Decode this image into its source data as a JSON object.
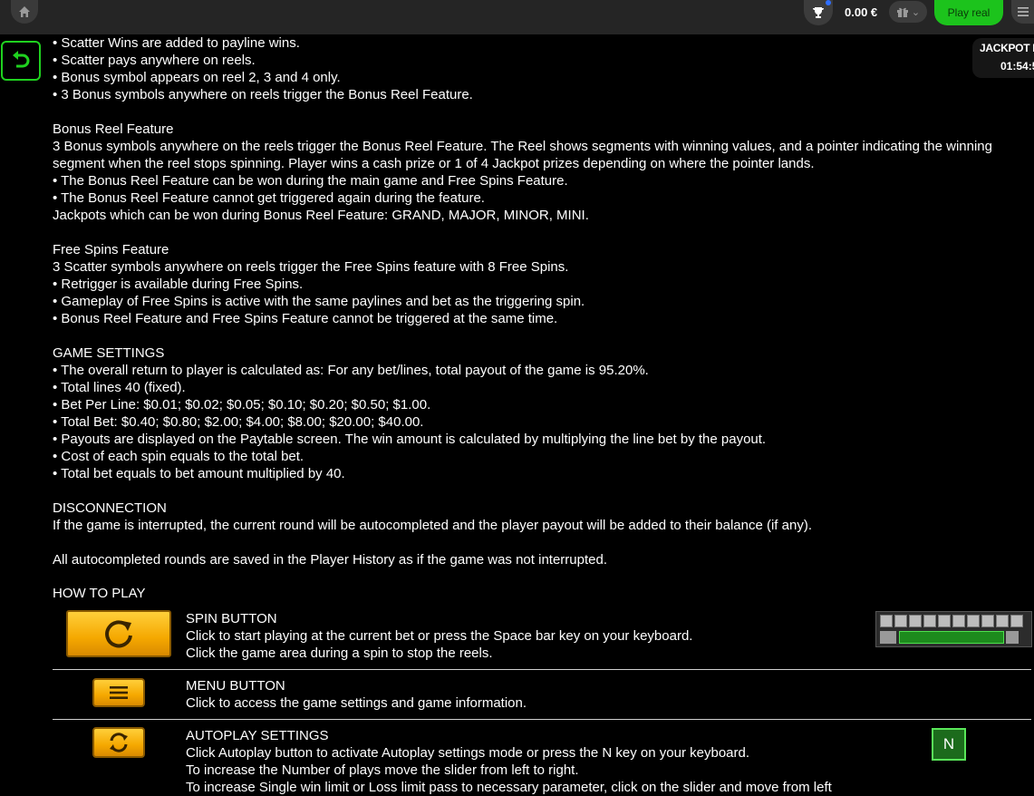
{
  "topbar": {
    "balance": "0.00 €",
    "play_real_label": "Play real"
  },
  "jackpot": {
    "label": "JACKPOT LA",
    "time": "01:54:5"
  },
  "icons": {
    "home": "home-icon",
    "trophy": "trophy-icon",
    "gift": "gift-icon",
    "menu": "hamburger-icon",
    "back": "back-arrow-icon"
  },
  "colors": {
    "accent_green": "#1cc31c",
    "button_orange": "#f5a800",
    "background": "#000000"
  },
  "rules": {
    "lines": [
      "• Scatter Wins are added to payline wins.",
      "• Scatter pays anywhere on reels.",
      "• Bonus symbol appears on reel 2, 3 and 4 only.",
      "• 3 Bonus symbols anywhere on reels trigger the Bonus Reel Feature.",
      "",
      "Bonus Reel Feature",
      "3 Bonus symbols anywhere on the reels trigger the Bonus Reel Feature. The Reel shows segments with winning values, and a pointer indicating the winning",
      "segment when the reel stops spinning. Player wins a cash prize or 1 of 4 Jackpot prizes depending on where the pointer lands.",
      "• The Bonus Reel Feature can be won during the main game and Free Spins Feature.",
      "• The Bonus Reel Feature cannot get triggered again during the feature.",
      "Jackpots which can be won during Bonus Reel Feature: GRAND, MAJOR, MINOR, MINI.",
      "",
      "Free Spins Feature",
      "3 Scatter symbols anywhere on reels trigger the Free Spins feature with 8 Free Spins.",
      "• Retrigger is available during Free Spins.",
      "• Gameplay of Free Spins is active with the same paylines and bet as the triggering spin.",
      "• Bonus Reel Feature and Free Spins Feature cannot be triggered at the same time.",
      "",
      "GAME SETTINGS",
      "• The overall return to player is calculated as: For any bet/lines, total payout of the game is 95.20%.",
      "• Total lines 40 (fixed).",
      "• Bet Per Line:  $0.01; $0.02; $0.05; $0.10; $0.20; $0.50; $1.00.",
      "• Total Bet:  $0.40; $0.80; $2.00; $4.00; $8.00; $20.00; $40.00.",
      "• Payouts are displayed on the Paytable screen. The win amount is calculated by multiplying the line bet by the payout.",
      "• Cost of each spin equals to the total bet.",
      "• Total bet equals to bet amount multiplied by 40.",
      "",
      "DISCONNECTION",
      "If the game is interrupted, the current round will be autocompleted and the player payout will be added to their balance (if any).",
      "",
      "All autocompleted rounds are saved in the Player History as if the game was not interrupted."
    ]
  },
  "how_to_play": {
    "title": "HOW TO PLAY",
    "spin": {
      "title": "SPIN BUTTON",
      "l1": "Click to start playing at the current bet or press the Space bar key on your keyboard.",
      "l2": "Click the game area during a spin to stop the reels."
    },
    "menu": {
      "title": "MENU BUTTON",
      "l1": "Click to access the game settings and game information."
    },
    "autoplay": {
      "title": "AUTOPLAY SETTINGS",
      "l1": "Click Autoplay button to activate Autoplay settings mode or press the N key on your keyboard.",
      "l2": "To increase the Number of plays move the slider from left to right.",
      "l3": "To increase Single win limit or Loss limit pass to necessary parameter, click on the slider and move from left"
    },
    "n_key": "N"
  }
}
